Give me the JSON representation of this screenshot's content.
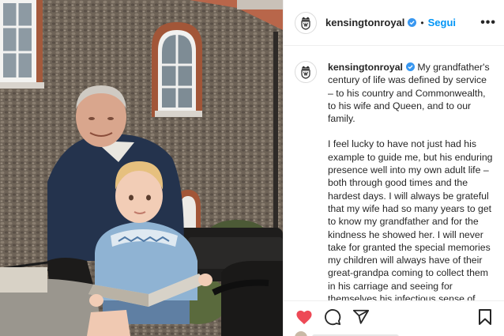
{
  "post": {
    "username": "kensingtonroyal",
    "separator": "•",
    "follow_label": "Segui",
    "more_label": "•••",
    "caption_paragraphs": [
      "My grandfather's century of life was defined by service – to his country and Commonwealth, to his wife and Queen, and to our family.",
      "I feel lucky to have not just had his example to guide me, but his enduring presence well into my own adult life – both through good times and the hardest days. I will always be grateful that my wife had so many years to get to know my grandfather and for the kindness he showed her. I will never take for granted the special memories my children will always have of their great-grandpa coming to collect them in his carriage and seeing for themselves his infectious sense of adventure as well as his mischievous"
    ]
  },
  "icons": {
    "avatar": "royal-crest-icon",
    "verified": "verified-badge-icon",
    "like": "heart-icon",
    "comment": "comment-icon",
    "share": "share-icon",
    "save": "bookmark-icon"
  },
  "colors": {
    "follow": "#0095f6",
    "verified": "#3897f0",
    "like": "#ed4956",
    "text": "#262626"
  }
}
